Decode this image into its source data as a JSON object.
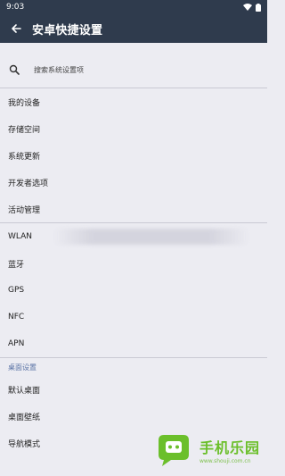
{
  "status": {
    "time": "9:03"
  },
  "appbar": {
    "title": "安卓快捷设置"
  },
  "search": {
    "placeholder": "搜索系统设置项"
  },
  "items_group1": [
    "我的设备",
    "存储空间",
    "系统更新",
    "开发者选项",
    "活动管理"
  ],
  "items_group2": [
    "WLAN",
    "蓝牙",
    "GPS",
    "NFC",
    "APN"
  ],
  "section": {
    "label": "桌面设置"
  },
  "items_group3": [
    "默认桌面",
    "桌面壁纸",
    "导航模式"
  ],
  "watermark": {
    "main": "手机乐园",
    "url": "www.shouji.com.cn"
  },
  "colors": {
    "header": "#2f3b4d",
    "background": "#ececf2",
    "section": "#5b74a6",
    "watermark": "#6bbf2b"
  },
  "icons": [
    "back-arrow-icon",
    "wifi-icon",
    "battery-icon",
    "search-icon"
  ]
}
